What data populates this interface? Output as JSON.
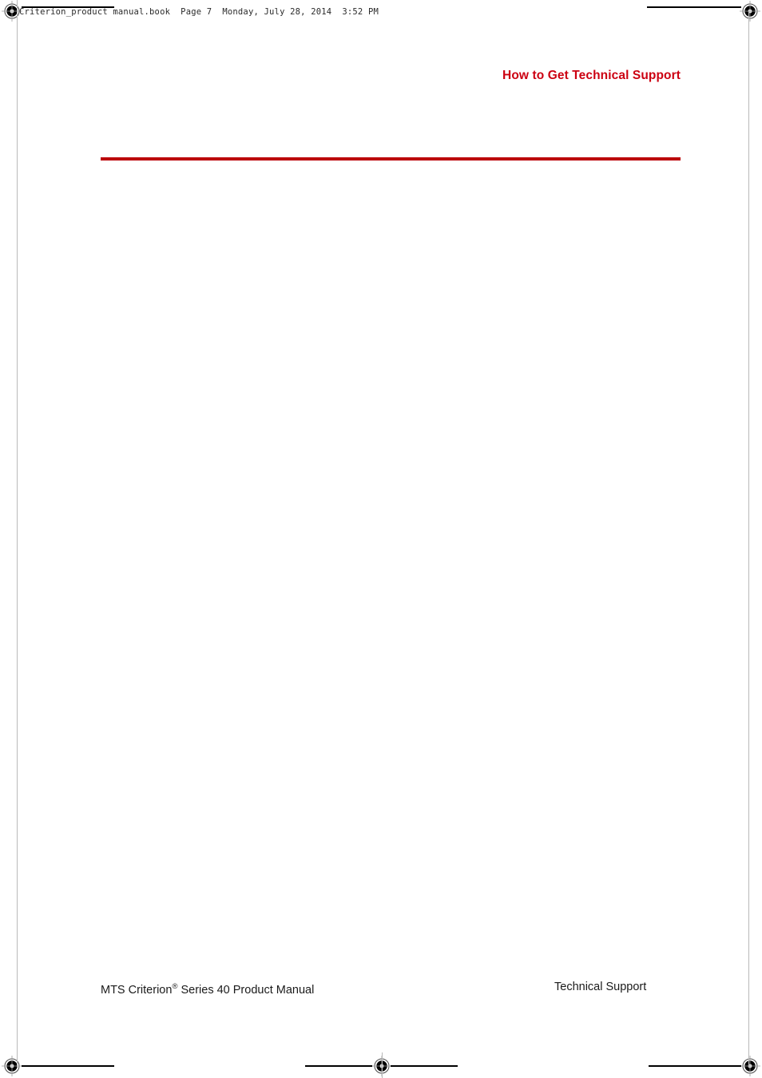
{
  "document": {
    "slug": "Criterion_product manual.book  Page 7  Monday, July 28, 2014  3:52 PM",
    "file_name": "Criterion_product manual.book",
    "page_label": "Page 7",
    "timestamp": "Monday, July 28, 2014  3:52 PM"
  },
  "running_head": {
    "title": "How to Get Technical Support",
    "color": "#cc0011"
  },
  "chapter_rule": {
    "color": "#bb0007"
  },
  "body": {
    "content": ""
  },
  "footer": {
    "left_prefix": "MTS Criterion",
    "left_registered_mark": "®",
    "left_suffix": " Series 40 Product Manual",
    "right": "Technical Support"
  },
  "print_marks": {
    "registration": [
      "registration-mark-top-left",
      "registration-mark-top-right",
      "registration-mark-bottom-left",
      "registration-mark-bottom-center",
      "registration-mark-bottom-right"
    ]
  }
}
